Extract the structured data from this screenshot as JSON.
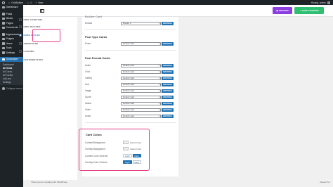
{
  "admin_bar": {
    "site_name": "GridBuilder",
    "comments_count": "0",
    "new_label": "New",
    "howdy": "Howdy, admin"
  },
  "admin_menu": {
    "items": [
      {
        "label": "Dashboard"
      },
      {
        "label": "Posts"
      },
      {
        "label": "Media"
      },
      {
        "label": "Pages"
      },
      {
        "label": "Comments"
      },
      {
        "label": "Appearance"
      },
      {
        "label": "Plugins"
      },
      {
        "label": "Users"
      },
      {
        "label": "Tools"
      },
      {
        "label": "Settings"
      },
      {
        "label": "Gridbuilder ᵂᴾ"
      }
    ],
    "submenu": [
      "Dashboard",
      "All Grids",
      "All Cards",
      "All Facets",
      "Add-ons",
      "Settings"
    ],
    "collapse_label": "Collapse menu"
  },
  "header": {
    "preview_label": "PREVIEW",
    "save_label": "SAVE CHANGES"
  },
  "plugin_nav": {
    "items": [
      {
        "label": "GRID CAROUSEL"
      },
      {
        "label": "GRID BUILDER"
      },
      {
        "label": "CARD STYLES"
      },
      {
        "label": "ANIMATIONS"
      },
      {
        "label": "LOADING"
      },
      {
        "label": "CUSTOMIZATION"
      }
    ]
  },
  "main": {
    "top_partial_title": "Builder Card",
    "top_row": {
      "label": "Default",
      "value": "Builder 2",
      "button": "BROWSE"
    },
    "post_type_title": "Post Type Cards",
    "post_type_rows": [
      {
        "label": "Posts",
        "value": "Default card",
        "button": "BROWSE"
      }
    ],
    "post_format_title": "Post Format Cards",
    "post_format_rows": [
      {
        "label": "Aside",
        "value": "Default card",
        "button": "BROWSE"
      },
      {
        "label": "Chat",
        "value": "Default card",
        "button": "BROWSE"
      },
      {
        "label": "Gallery",
        "value": "Default card",
        "button": "BROWSE"
      },
      {
        "label": "Link",
        "value": "Default card",
        "button": "BROWSE"
      },
      {
        "label": "Image",
        "value": "Default card",
        "button": "BROWSE"
      },
      {
        "label": "Quote",
        "value": "Default card",
        "button": "BROWSE"
      },
      {
        "label": "Status",
        "value": "Default card",
        "button": "BROWSE"
      },
      {
        "label": "Video",
        "value": "Default card",
        "button": "BROWSE"
      },
      {
        "label": "Audio",
        "value": "Default card",
        "button": "BROWSE"
      }
    ],
    "card_colors": {
      "title": "Card Colors",
      "content_background_label": "Content Background",
      "overlay_background_label": "Overlay Background",
      "select_color_label": "Select Color",
      "content_scheme_label": "Content Color Scheme",
      "overlay_scheme_label": "Overlay Color Scheme",
      "content_scheme": {
        "options": [
          "Dark",
          "Light"
        ],
        "selected": "Dark"
      },
      "overlay_scheme": {
        "options": [
          "Light",
          "Dark"
        ],
        "selected": "Light"
      }
    }
  },
  "footer": {
    "left": "Thank you for creating with WordPress.",
    "right": "Version 5.4"
  },
  "colors": {
    "admin_dark": "#1d2327",
    "wp_blue": "#2271b1",
    "preview_purple": "#8c3ee0",
    "save_green": "#2fbf71",
    "highlight_pink": "#e53b84"
  }
}
